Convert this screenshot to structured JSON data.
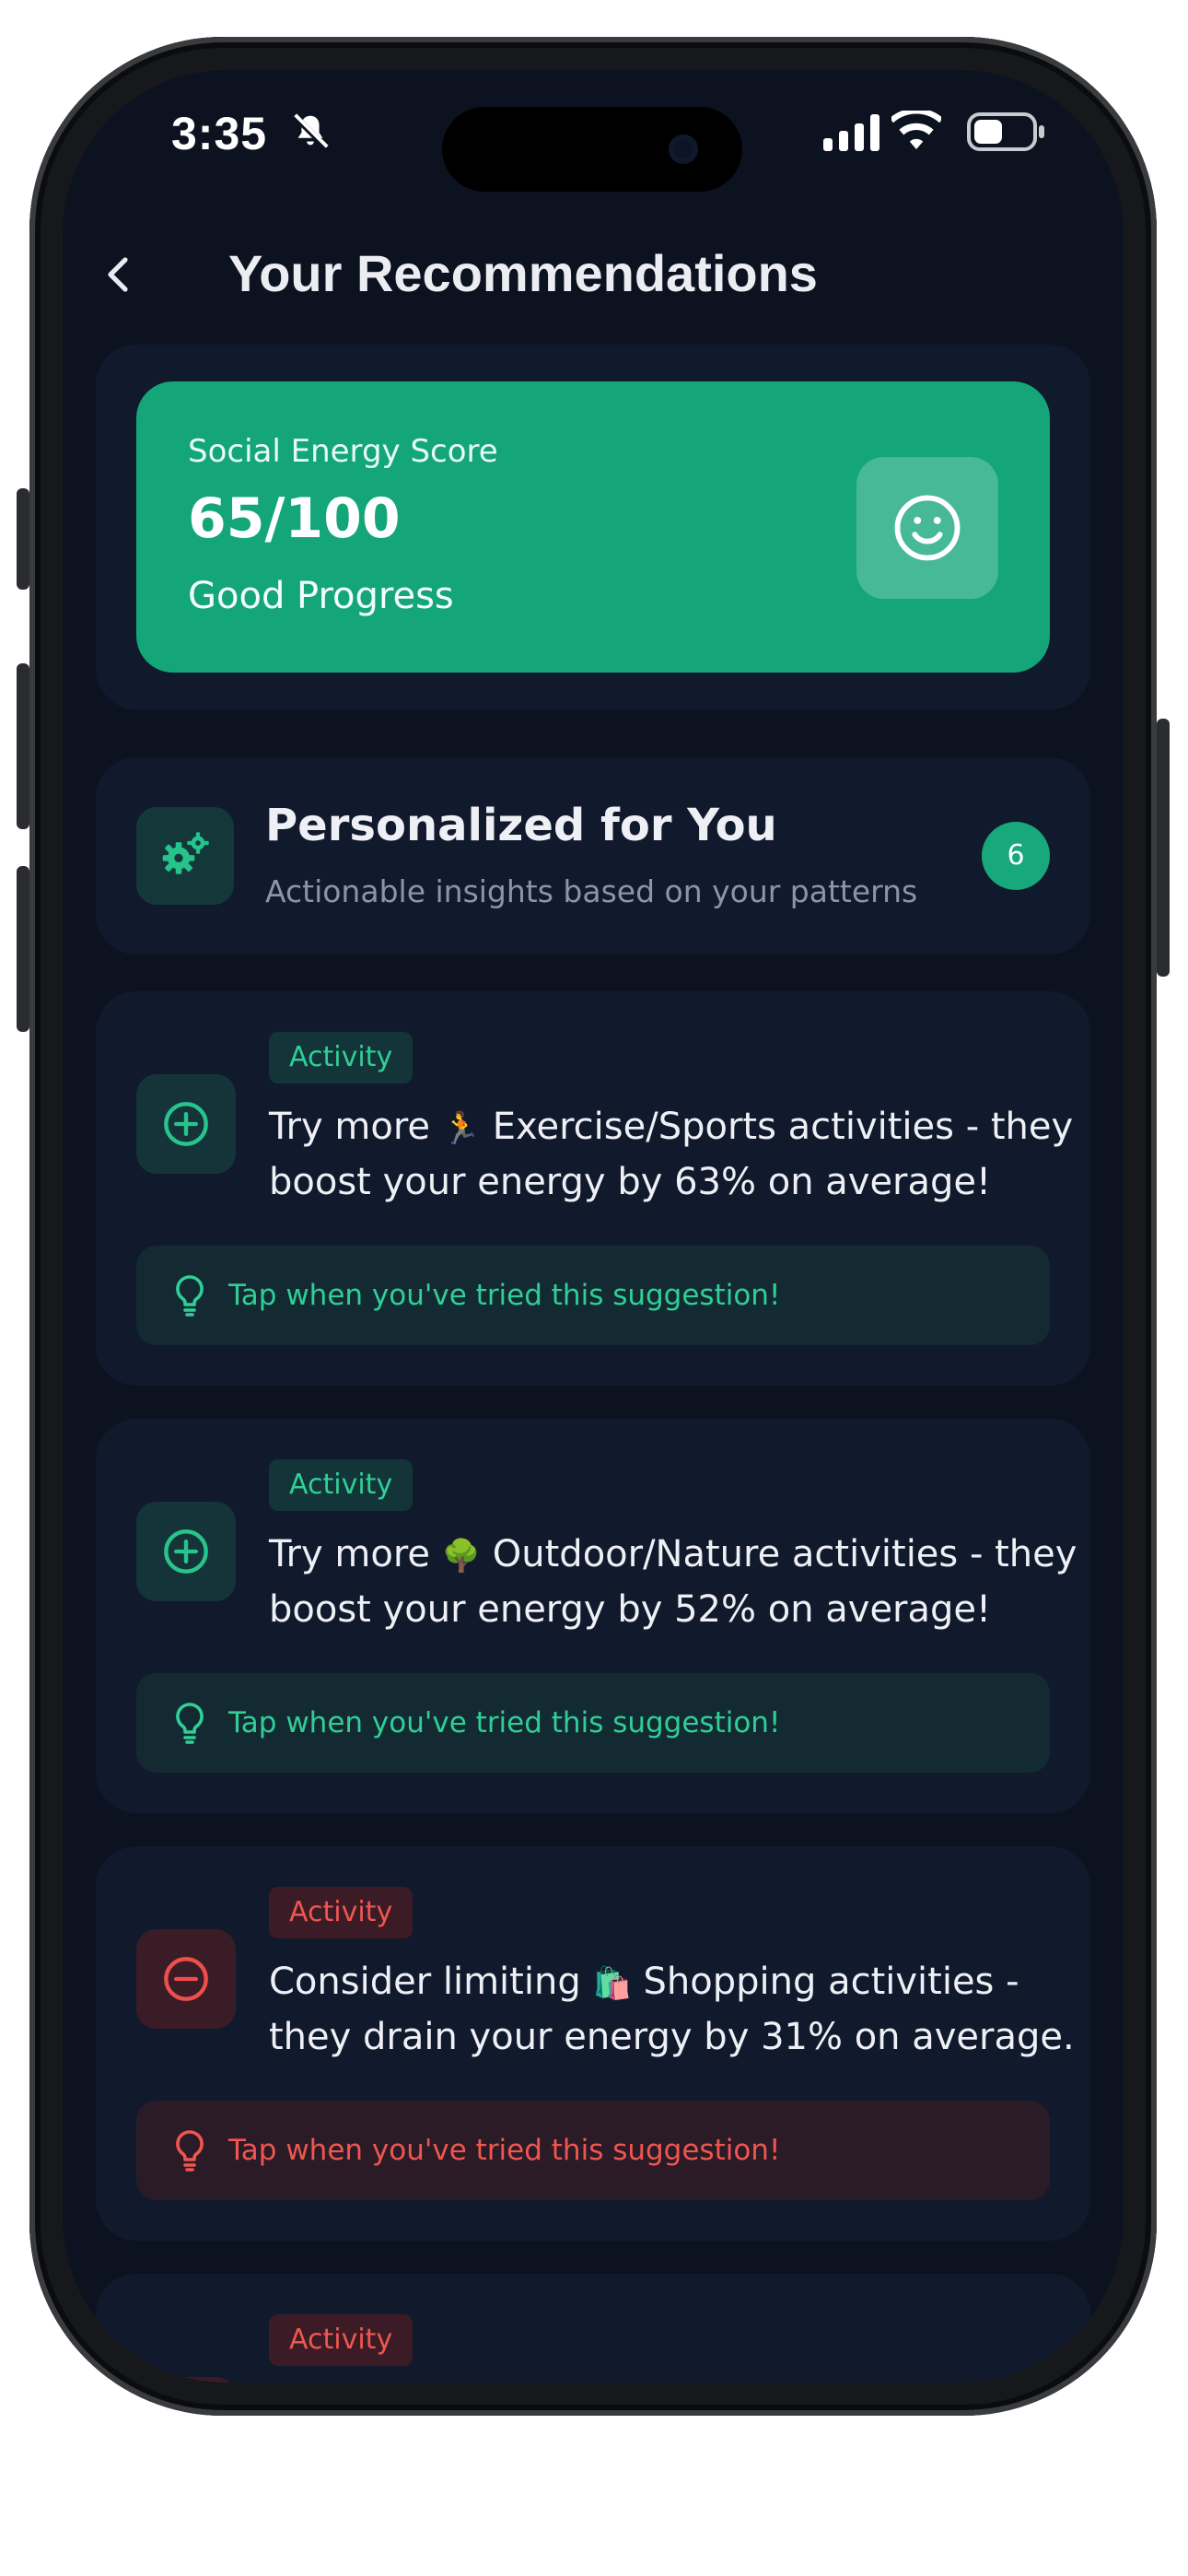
{
  "status_bar": {
    "time": "3:35"
  },
  "header": {
    "title": "Your Recommendations"
  },
  "score_card": {
    "label": "Social Energy Score",
    "value": "65/100",
    "status": "Good Progress"
  },
  "personalized": {
    "title": "Personalized for You",
    "subtitle": "Actionable insights based on your patterns",
    "count": "6"
  },
  "recommendations": [
    {
      "tag": "Activity",
      "kind": "positive",
      "icon": "plus-circle-icon",
      "text_before": "Try more",
      "emoji": "🏃",
      "text_after": "Exercise/Sports activities - they boost your energy by 63% on average!",
      "hint": "Tap when you've tried this suggestion!"
    },
    {
      "tag": "Activity",
      "kind": "positive",
      "icon": "plus-circle-icon",
      "text_before": "Try more",
      "emoji": "🌳",
      "text_after": "Outdoor/Nature activities - they boost your energy by 52% on average!",
      "hint": "Tap when you've tried this suggestion!"
    },
    {
      "tag": "Activity",
      "kind": "negative",
      "icon": "minus-circle-icon",
      "text_before": "Consider limiting",
      "emoji": "🛍️",
      "text_after": "Shopping activities - they drain your energy by 31% on average.",
      "hint": "Tap when you've tried this suggestion!"
    },
    {
      "tag": "Activity",
      "kind": "negative"
    }
  ],
  "colors": {
    "background": "#0c1220",
    "card": "#111a2c",
    "accent_green": "#14a679",
    "positive_text": "#2fcf96",
    "negative_text": "#f0564f"
  }
}
